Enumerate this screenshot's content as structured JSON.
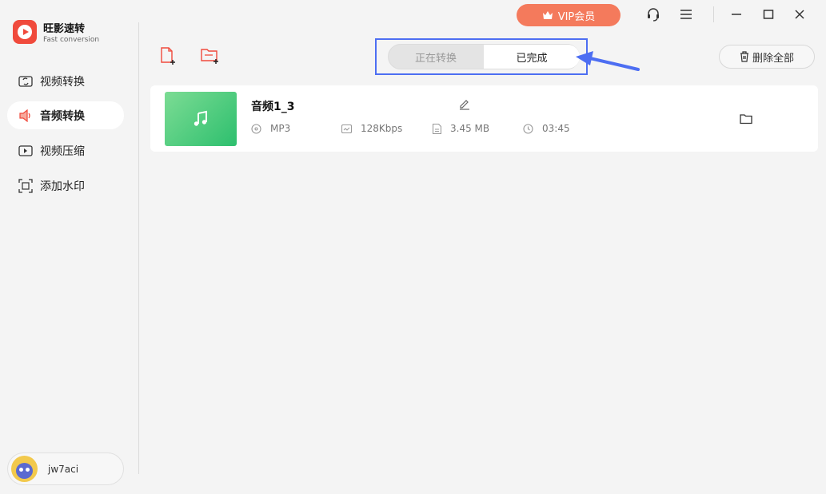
{
  "app": {
    "name": "旺影速转",
    "subtitle": "Fast conversion",
    "colors": {
      "brand": "#f04a3c",
      "vip": "#f47a5c",
      "highlight": "#4d6ef2",
      "thumb": "#2dbf6e"
    }
  },
  "sidebar": {
    "items": [
      {
        "label": "视频转换",
        "icon": "video-convert-icon"
      },
      {
        "label": "音频转换",
        "icon": "audio-convert-icon",
        "active": true
      },
      {
        "label": "视频压缩",
        "icon": "video-compress-icon"
      },
      {
        "label": "添加水印",
        "icon": "watermark-icon"
      }
    ],
    "user": {
      "name": "jw7aci",
      "icon": "avatar"
    }
  },
  "header": {
    "vip_label": "VIP会员",
    "icons": [
      "crown-icon",
      "headset-icon",
      "menu-icon",
      "minimize-icon",
      "maximize-icon",
      "close-icon"
    ]
  },
  "toolbar": {
    "add_file_icon": "add-file-icon",
    "add_folder_icon": "add-folder-icon",
    "tabs": [
      {
        "label": "正在转换"
      },
      {
        "label": "已完成",
        "selected": true
      }
    ],
    "delete_all_label": "删除全部"
  },
  "files": [
    {
      "name": "音频1_3",
      "format": "MP3",
      "bitrate": "128Kbps",
      "size": "3.45 MB",
      "duration": "03:45"
    }
  ]
}
